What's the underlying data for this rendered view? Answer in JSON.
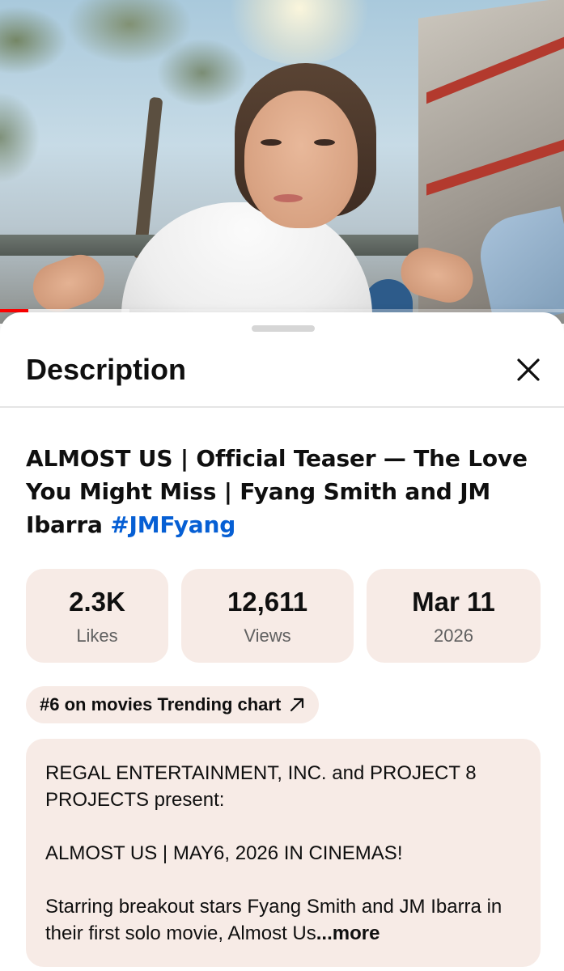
{
  "video": {
    "progress_fraction": 0.05,
    "buffer_fraction": 0.23,
    "colors": {
      "progress": "#ff0000"
    }
  },
  "sheet": {
    "title": "Description",
    "close_icon": "close-icon"
  },
  "video_title": {
    "text": "ALMOST US | Official Teaser — The Love You Might Miss | Fyang Smith and JM Ibarra ",
    "hashtag": "#JMFyang",
    "hashtag_color": "#065fd4"
  },
  "stats": {
    "likes": {
      "value": "2.3K",
      "label": "Likes"
    },
    "views": {
      "value": "12,611",
      "label": "Views"
    },
    "date": {
      "value": "Mar 11",
      "label": "2026"
    }
  },
  "trending_chip": {
    "label": "#6 on movies Trending chart",
    "icon": "arrow-up-right-icon"
  },
  "description": {
    "line1": "REGAL ENTERTAINMENT, INC. and PROJECT 8 PROJECTS present:",
    "line2": "ALMOST US | MAY6, 2026 IN CINEMAS!",
    "line3": "Starring breakout stars Fyang Smith and JM Ibarra in their first solo movie, Almost Us",
    "more_label": "...more"
  },
  "colors": {
    "card_bg": "#f7ebe6",
    "text_primary": "#0f0f0f",
    "text_secondary": "#606060"
  }
}
